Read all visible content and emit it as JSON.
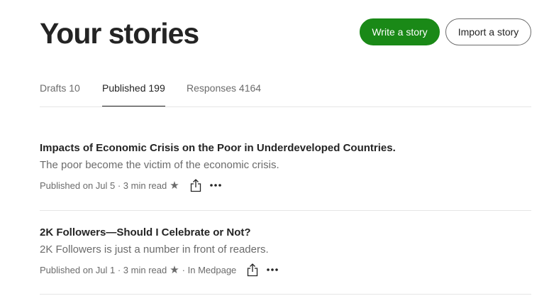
{
  "header": {
    "title": "Your stories",
    "write_label": "Write a story",
    "import_label": "Import a story"
  },
  "tabs": [
    {
      "label": "Drafts 10",
      "active": false
    },
    {
      "label": "Published 199",
      "active": true
    },
    {
      "label": "Responses 4164",
      "active": false
    }
  ],
  "stories": [
    {
      "title": "Impacts of Economic Crisis on the Poor in Underdeveloped Countries.",
      "subtitle": "The poor become the victim of the economic crisis.",
      "meta": "Published on Jul 5 · 3 min read",
      "publication": ""
    },
    {
      "title": "2K Followers—Should I Celebrate or Not?",
      "subtitle": "2K Followers is just a number in front of readers.",
      "meta": "Published on Jul 1 · 3 min read",
      "publication": "· In Medpage"
    }
  ],
  "icons": {
    "star": "star-icon",
    "share": "share-icon",
    "more": "more-icon"
  },
  "colors": {
    "accent": "#1a8917",
    "text": "#242424",
    "muted": "#6b6b6b",
    "divider": "#e6e6e6"
  }
}
